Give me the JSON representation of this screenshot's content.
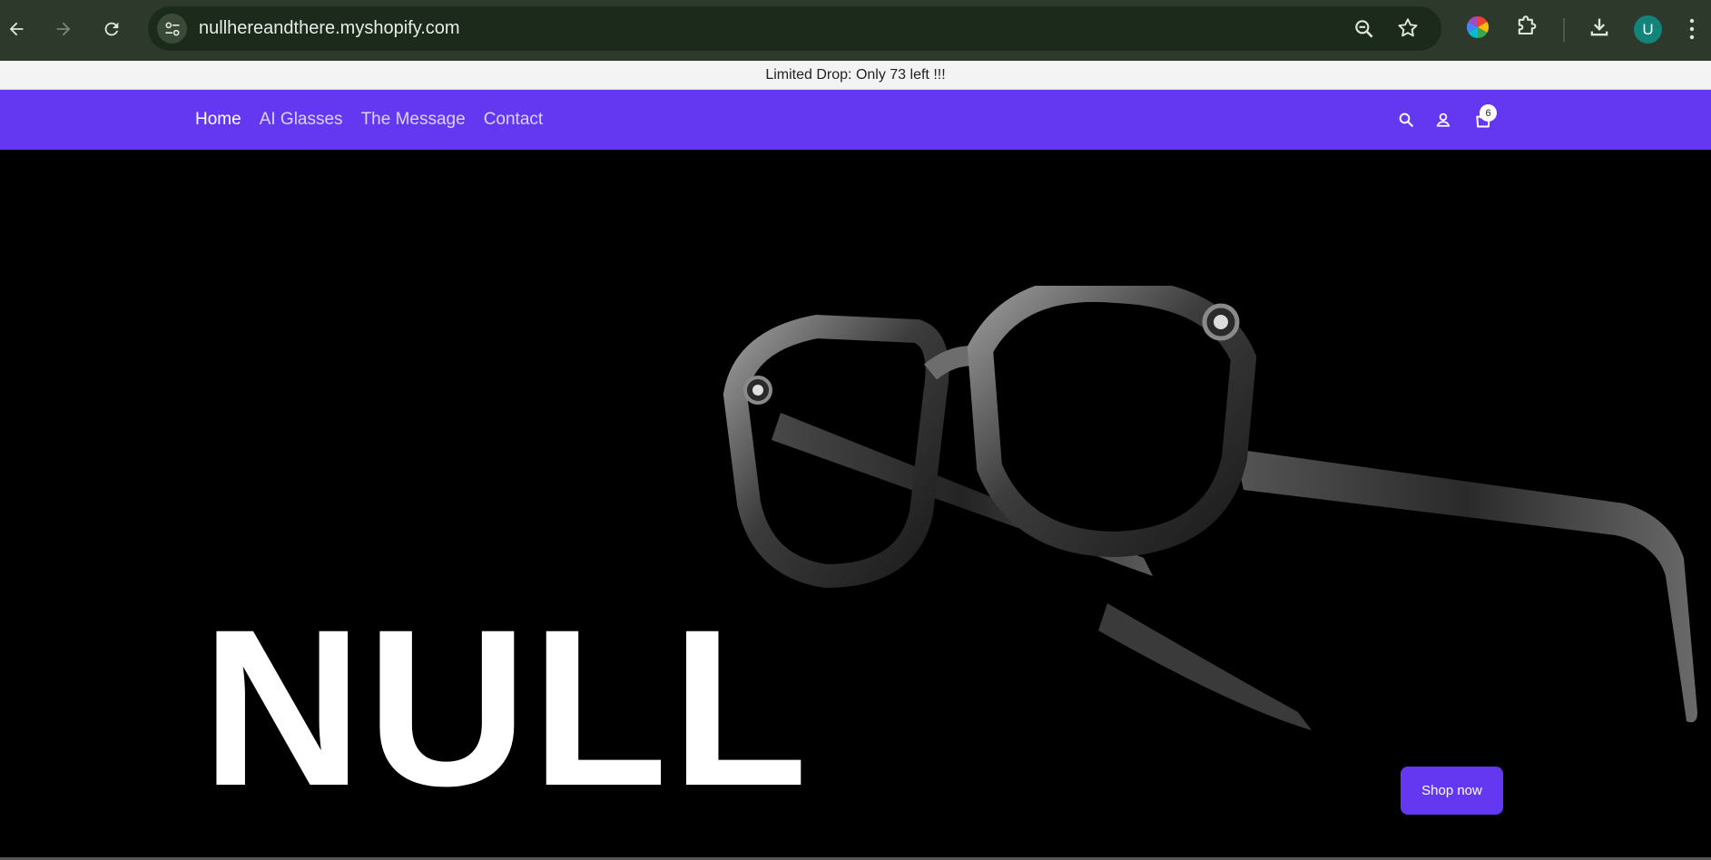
{
  "browser": {
    "url": "nullhereandthere.myshopify.com",
    "profile_initial": "U",
    "icons": [
      "back-icon",
      "forward-icon",
      "reload-icon",
      "site-settings-icon",
      "zoom-icon",
      "bookmark-star-icon",
      "color-extension-icon",
      "extensions-puzzle-icon",
      "download-icon",
      "menu-dots-icon"
    ]
  },
  "announcement": {
    "text": "Limited Drop: Only 73 left !!!"
  },
  "header": {
    "nav": [
      {
        "label": "Home",
        "active": true
      },
      {
        "label": "AI Glasses",
        "active": false
      },
      {
        "label": "The Message",
        "active": false
      },
      {
        "label": "Contact",
        "active": false
      }
    ],
    "cart_count": "6",
    "icons": [
      "search-icon",
      "account-icon",
      "cart-icon"
    ]
  },
  "hero": {
    "wordmark": "NULL",
    "cta_label": "Shop now"
  },
  "colors": {
    "brand": "#6338f0",
    "chrome": "#2d3a2b",
    "hero_bg": "#000000"
  }
}
